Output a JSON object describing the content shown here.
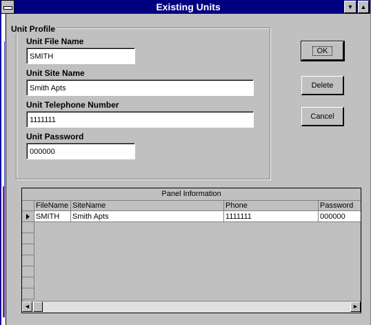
{
  "window": {
    "title": "Existing Units",
    "scroll_up_glyph": "▲",
    "dropdown_glyph": "▼"
  },
  "unit_profile": {
    "group_label": "Unit Profile",
    "file_name_label": "Unit File Name",
    "file_name_value": "SMITH",
    "site_name_label": "Unit Site Name",
    "site_name_value": "Smith Apts",
    "telephone_label": "Unit Telephone Number",
    "telephone_value": "1111111",
    "password_label": "Unit Password",
    "password_value": "000000"
  },
  "buttons": {
    "ok": "OK",
    "delete": "Delete",
    "cancel": "Cancel"
  },
  "panel": {
    "caption": "Panel Information",
    "columns": [
      "FileName",
      "SiteName",
      "Phone",
      "Password"
    ],
    "rows": [
      [
        "SMITH",
        "Smith Apts",
        "1111111",
        "000000"
      ]
    ],
    "scroll_left_glyph": "◄",
    "scroll_right_glyph": "►"
  }
}
